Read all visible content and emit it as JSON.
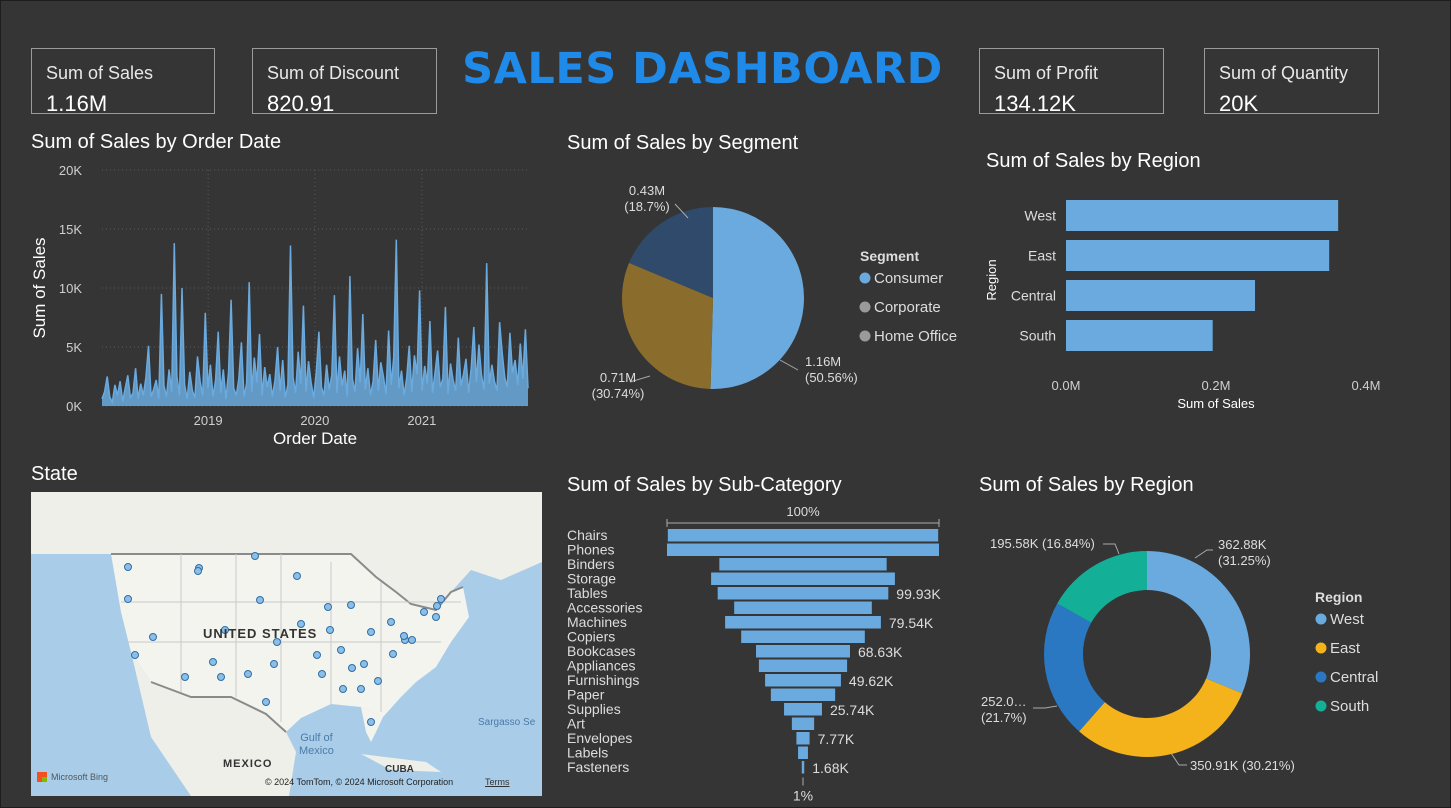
{
  "header": {
    "title": "SALES DASHBOARD"
  },
  "kpis": [
    {
      "label": "Sum of Sales",
      "value": "1.16M"
    },
    {
      "label": "Sum of Discount",
      "value": "820.91"
    },
    {
      "label": "Sum of Profit",
      "value": "134.12K"
    },
    {
      "label": "Sum of Quantity",
      "value": "20K"
    }
  ],
  "colors": {
    "accent": "#1f8ae8",
    "bar": "#6aaade",
    "background": "#353535"
  },
  "map": {
    "title": "State",
    "country_label": "UNITED STATES",
    "mexico_label": "MEXICO",
    "cuba_label": "CUBA",
    "gulf_label_1": "Gulf of",
    "gulf_label_2": "Mexico",
    "sea_label": "Sargasso Se",
    "logo_text": "Microsoft Bing",
    "copyright": "© 2024 TomTom, © 2024 Microsoft Corporation",
    "terms": "Terms"
  },
  "chart_data": [
    {
      "id": "sales_by_date",
      "type": "line",
      "title": "Sum of Sales by Order Date",
      "xlabel": "Order Date",
      "ylabel": "Sum of Sales",
      "yticks": [
        "0K",
        "5K",
        "10K",
        "15K",
        "20K"
      ],
      "ylim": [
        0,
        20000
      ],
      "xticks": [
        "2019",
        "2020",
        "2021"
      ],
      "x_range": [
        "2018-01-03",
        "2021-12-30"
      ],
      "values": [
        600,
        1200,
        2500,
        800,
        300,
        1800,
        900,
        2100,
        400,
        1500,
        2600,
        700,
        1100,
        3200,
        600,
        1900,
        900,
        2400,
        5100,
        800,
        1400,
        2200,
        600,
        9500,
        1700,
        800,
        3100,
        1200,
        13800,
        2500,
        900,
        10000,
        1800,
        600,
        2900,
        1300,
        700,
        4200,
        2100,
        900,
        7900,
        1500,
        3500,
        800,
        2200,
        6300,
        1100,
        3100,
        600,
        2800,
        9000,
        1500,
        900,
        2300,
        5400,
        800,
        1900,
        10500,
        1200,
        4100,
        2000,
        6100,
        900,
        3300,
        1600,
        2700,
        800,
        2200,
        5000,
        1300,
        3900,
        700,
        1800,
        13600,
        2400,
        1100,
        4600,
        1900,
        8500,
        1200,
        3800,
        2000,
        700,
        2900,
        6300,
        1600,
        900,
        3500,
        1400,
        2600,
        9400,
        1100,
        4200,
        1700,
        3000,
        800,
        11000,
        2300,
        1200,
        4900,
        2000,
        7800,
        1400,
        3200,
        900,
        2100,
        5600,
        1300,
        3700,
        2500,
        1000,
        6400,
        1800,
        4100,
        14100,
        1500,
        3000,
        900,
        2400,
        5100,
        1200,
        4300,
        2700,
        9800,
        1300,
        3400,
        1900,
        7200,
        1100,
        2900,
        4700,
        1600,
        2300,
        8400,
        1000,
        3600,
        2200,
        1300,
        5800,
        1700,
        2700,
        4000,
        1100,
        3200,
        6700,
        2000,
        5200,
        2600,
        1400,
        12100,
        1900,
        3500,
        2100,
        1300,
        7100,
        4500,
        2400,
        1600,
        6200,
        2800,
        3900,
        1800,
        5300,
        2300,
        6500,
        1500
      ]
    },
    {
      "id": "sales_by_segment",
      "type": "pie",
      "title": "Sum of Sales by Segment",
      "legend_title": "Segment",
      "legend": "right",
      "slices": [
        {
          "name": "Consumer",
          "value": 1.16,
          "label": "1.16M",
          "pct": "(50.56%)",
          "color": "#6aaade"
        },
        {
          "name": "Corporate",
          "value": 0.71,
          "label": "0.71M",
          "pct": "(30.74%)",
          "color": "#8a6d2c"
        },
        {
          "name": "Home Office",
          "value": 0.43,
          "label": "0.43M",
          "pct": "(18.7%)",
          "color": "#2f4a6a"
        }
      ],
      "legend_dot_colors": [
        "#6aaade",
        "#9a9a9a",
        "#9a9a9a"
      ]
    },
    {
      "id": "sales_by_region_bar",
      "type": "bar",
      "orientation": "horizontal",
      "title": "Sum of Sales by Region",
      "xlabel": "Sum of Sales",
      "ylabel": "Region",
      "categories": [
        "West",
        "East",
        "Central",
        "South"
      ],
      "values": [
        362880,
        350910,
        252030,
        195580
      ],
      "xlim": [
        0,
        400000
      ],
      "xticks": [
        "0.0M",
        "0.2M",
        "0.4M"
      ]
    },
    {
      "id": "sales_by_subcategory",
      "type": "bar",
      "title": "Sum of Sales by Sub-Category",
      "categories": [
        "Chairs",
        "Phones",
        "Binders",
        "Storage",
        "Tables",
        "Accessories",
        "Machines",
        "Copiers",
        "Bookcases",
        "Appliances",
        "Furnishings",
        "Paper",
        "Supplies",
        "Art",
        "Envelopes",
        "Labels",
        "Fasteners"
      ],
      "values": [
        328000,
        330000,
        203000,
        223000,
        207000,
        167000,
        189000,
        150000,
        114000,
        107000,
        92000,
        78000,
        46000,
        27000,
        16000,
        12000,
        3000
      ],
      "value_labels": [
        "",
        "",
        "",
        "",
        "99.93K",
        "",
        "79.54K",
        "",
        "68.63K",
        "",
        "49.62K",
        "",
        "25.74K",
        "",
        "7.77K",
        "",
        "1.68K"
      ],
      "top_label": "100%",
      "bottom_label": "1%"
    },
    {
      "id": "sales_by_region_donut",
      "type": "pie",
      "title": "Sum of Sales by Region",
      "legend_title": "Region",
      "legend": "right",
      "slices": [
        {
          "name": "West",
          "value": 362.88,
          "label": "362.88K",
          "pct": "(31.25%)",
          "color": "#6aaade"
        },
        {
          "name": "East",
          "value": 350.91,
          "label": "350.91K (30.21%)",
          "pct": "",
          "color": "#f5b31b"
        },
        {
          "name": "Central",
          "value": 252.03,
          "label": "252.0…",
          "pct": "(21.7%)",
          "color": "#2a78c2"
        },
        {
          "name": "South",
          "value": 195.58,
          "label": "195.58K (16.84%)",
          "pct": "",
          "color": "#13b097"
        }
      ]
    }
  ]
}
